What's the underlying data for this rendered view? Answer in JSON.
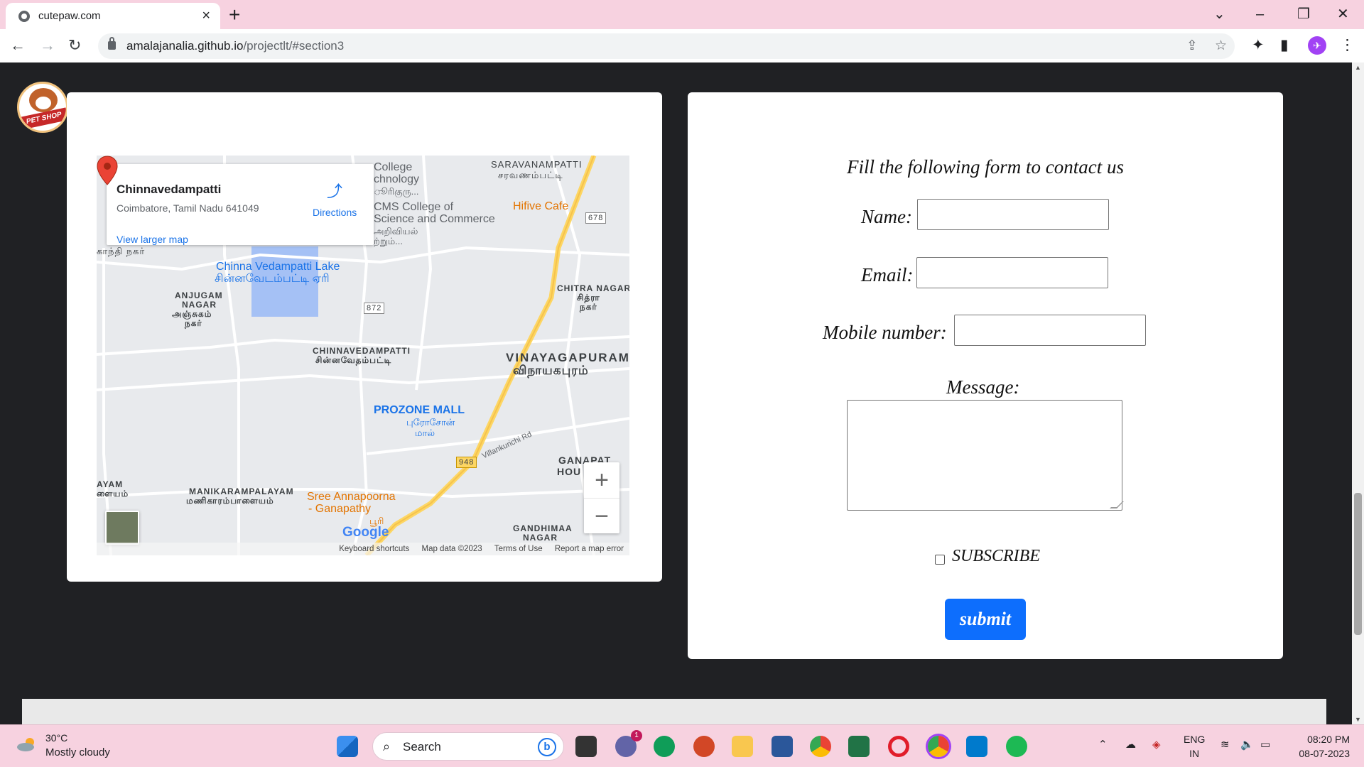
{
  "browser": {
    "tab_title": "cutepaw.com",
    "url_host": "amalajanalia.github.io",
    "url_path": "/projectlt/#section3"
  },
  "map": {
    "place_name": "Chinnavedampatti",
    "address": "Coimbatore, Tamil Nadu 641049",
    "directions_label": "Directions",
    "larger_map_link": "View larger map",
    "labels": {
      "college1": "College",
      "college2": "chnology",
      "college3": "ூரிகுரு...",
      "cms1": "CMS College of",
      "cms2": "Science and Commerce",
      "cms3": "அறிவியல்",
      "cms4": "ற்றும்...",
      "saravanampatti": "SARAVANAMPATTI",
      "saravanampatti_ta": "சரவணம்பட்டி",
      "hifive": "Hifive Cafe",
      "road678": "678",
      "road872": "872",
      "road948": "948",
      "lake1": "Chinna Vedampatti Lake",
      "lake2": "சின்னவேடம்பட்டி ஏரி",
      "gandhi_ta": "காந்தி நகர்",
      "anjugam1": "ANJUGAM",
      "anjugam2": "NAGAR",
      "anjugam3": "அஞ்சுகம்",
      "anjugam4": "நகர்",
      "chitra1": "CHITRA NAGAR",
      "chitra2": "சித்ரா",
      "chitra3": "நகர்",
      "chinna1": "CHINNAVEDAMPATTI",
      "chinna2": "சின்னவேதம்பட்டி",
      "vinayaga1": "VINAYAGAPURAM",
      "vinayaga2": "விநாயகபுரம்",
      "prozone1": "PROZONE MALL",
      "prozone2": "புரோசோன்",
      "prozone3": "மால்",
      "villankurichi": "Villankurichi Rd",
      "ganapathy1": "GANAPAT",
      "ganapathy2": "HOU",
      "mani1": "MANIKARAMPALAYAM",
      "mani2": "மணிகாரம்பாளையம்",
      "ayam1": "AYAM",
      "ayam2": "ளையம்",
      "sree1": "Sree Annapoorna",
      "sree2": "- Ganapathy",
      "sree3": "பூரி",
      "gandhimaa1": "GANDHIMAA",
      "gandhimaa2": "NAGAR",
      "google": "Google"
    },
    "attribution": {
      "shortcuts": "Keyboard shortcuts",
      "data": "Map data ©2023",
      "terms": "Terms of Use",
      "report": "Report a map error"
    },
    "zoom_in": "+",
    "zoom_out": "−"
  },
  "form": {
    "title": "Fill the following form to contact us",
    "name_label": "Name:",
    "email_label": "Email:",
    "mobile_label": "Mobile number:",
    "message_label": "Message:",
    "subscribe_label": "SUBSCRIBE",
    "submit_label": "submit"
  },
  "logo": {
    "text": "PET SHOP"
  },
  "taskbar": {
    "temperature": "30°C",
    "weather": "Mostly cloudy",
    "search_placeholder": "Search",
    "chat_badge": "1",
    "lang1": "ENG",
    "lang2": "IN",
    "time": "08:20 PM",
    "date": "08-07-2023"
  },
  "colors": {
    "accent": "#0d6efd",
    "chrome": "#f7d2e0",
    "page_bg": "#202124"
  }
}
